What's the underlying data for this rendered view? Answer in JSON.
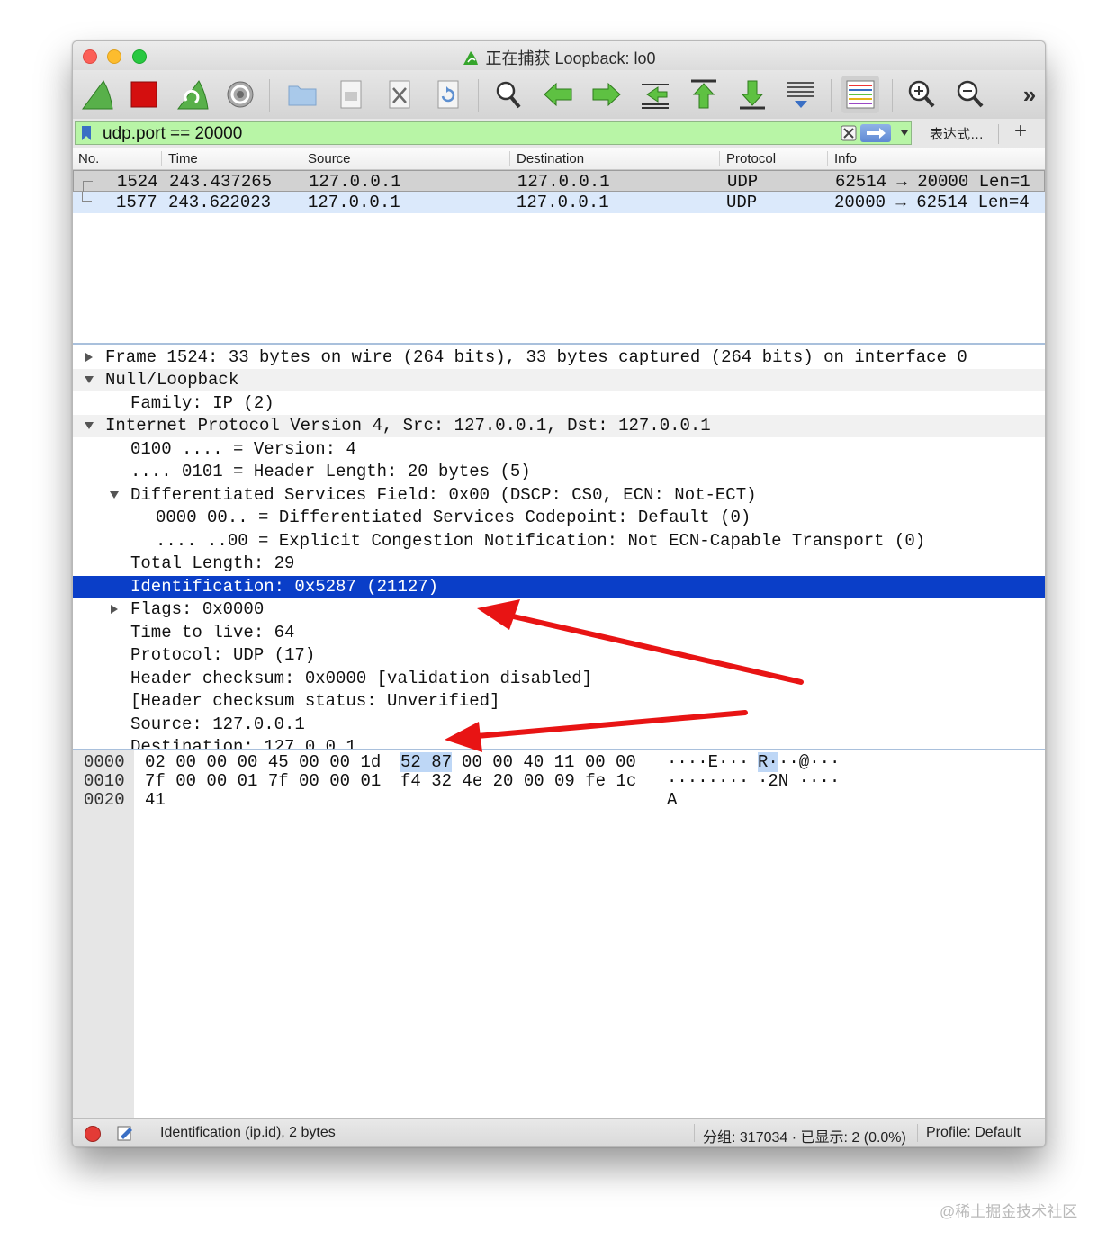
{
  "window": {
    "title": "正在捕获 Loopback: lo0"
  },
  "toolbar": {
    "icons": [
      "start-capture-icon",
      "stop-capture-icon",
      "restart-capture-icon",
      "capture-options-icon",
      "open-file-icon",
      "save-file-icon",
      "close-file-icon",
      "reload-file-icon",
      "find-packet-icon",
      "go-back-icon",
      "go-forward-icon",
      "go-to-packet-icon",
      "first-packet-icon",
      "last-packet-icon",
      "autoscroll-icon",
      "colorize-icon",
      "zoom-in-icon",
      "zoom-out-icon",
      "more-icon"
    ],
    "overflow_label": "»"
  },
  "filter": {
    "value": "udp.port == 20000",
    "expression_label": "表达式…",
    "add_label": "+",
    "bg_color": "#b8f5a6"
  },
  "packet_list": {
    "columns": [
      "No.",
      "Time",
      "Source",
      "Destination",
      "Protocol",
      "Info"
    ],
    "rows": [
      {
        "no": "1524",
        "time": "243.437265",
        "source": "127.0.0.1",
        "destination": "127.0.0.1",
        "protocol": "UDP",
        "info": "62514 → 20000 Len=1"
      },
      {
        "no": "1577",
        "time": "243.622023",
        "source": "127.0.0.1",
        "destination": "127.0.0.1",
        "protocol": "UDP",
        "info": "20000 → 62514 Len=4"
      }
    ]
  },
  "details": {
    "rows": [
      {
        "text": "Frame 1524: 33 bytes on wire (264 bits), 33 bytes captured (264 bits) on interface 0"
      },
      {
        "text": "Null/Loopback"
      },
      {
        "text": "Family: IP (2)"
      },
      {
        "text": "Internet Protocol Version 4, Src: 127.0.0.1, Dst: 127.0.0.1"
      },
      {
        "text": "0100 .... = Version: 4"
      },
      {
        "text": ".... 0101 = Header Length: 20 bytes (5)"
      },
      {
        "text": "Differentiated Services Field: 0x00 (DSCP: CS0, ECN: Not-ECT)"
      },
      {
        "text": "0000 00.. = Differentiated Services Codepoint: Default (0)"
      },
      {
        "text": ".... ..00 = Explicit Congestion Notification: Not ECN-Capable Transport (0)"
      },
      {
        "text": "Total Length: 29"
      },
      {
        "text": "Identification: 0x5287 (21127)"
      },
      {
        "text": "Flags: 0x0000"
      },
      {
        "text": "Time to live: 64"
      },
      {
        "text": "Protocol: UDP (17)"
      },
      {
        "text": "Header checksum: 0x0000 [validation disabled]"
      },
      {
        "text": "[Header checksum status: Unverified]"
      },
      {
        "text": "Source: 127.0.0.1"
      },
      {
        "text": "Destination: 127.0.0.1"
      }
    ]
  },
  "bytes": {
    "rows": [
      {
        "offset": "0000",
        "hex_a": "02 00 00 00 45 00 00 1d",
        "hex_hl": "52 87",
        "hex_b": "00 00 40 11 00 00",
        "ascii_a": "····E···",
        "ascii_hl": "R·",
        "ascii_b": "··@···"
      },
      {
        "offset": "0010",
        "hex_a": "7f 00 00 01 7f 00 00 01",
        "hex_hl": "",
        "hex_b": "f4 32 4e 20 00 09 fe 1c",
        "ascii_a": "········",
        "ascii_hl": "",
        "ascii_b": "·2N ····"
      },
      {
        "offset": "0020",
        "hex_a": "41",
        "hex_hl": "",
        "hex_b": "",
        "ascii_a": "A",
        "ascii_hl": "",
        "ascii_b": ""
      }
    ]
  },
  "status": {
    "field": "Identification (ip.id), 2 bytes",
    "stats": "分组: 317034 · 已显示: 2 (0.0%)",
    "profile": "Profile: Default"
  },
  "watermark": "@稀土掘金技术社区",
  "colors": {
    "selected_row": "#0a3ec8",
    "annotation_arrow": "#e81414"
  }
}
